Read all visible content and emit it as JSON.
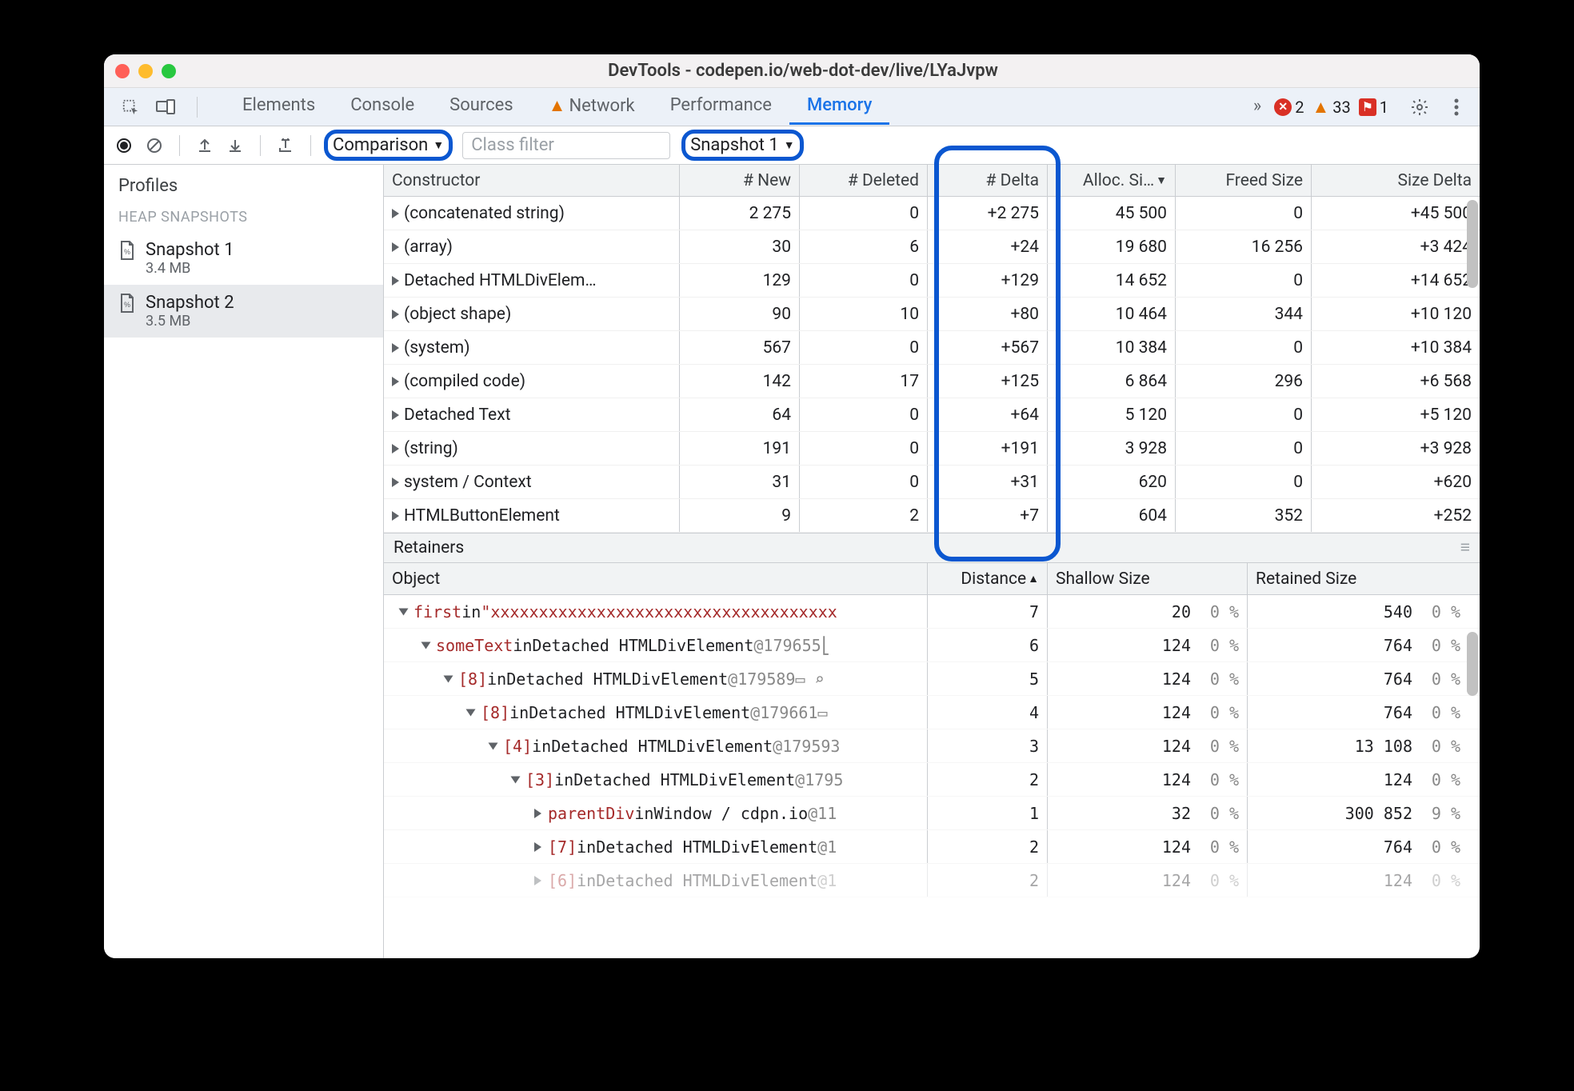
{
  "window": {
    "title": "DevTools - codepen.io/web-dot-dev/live/LYaJvpw"
  },
  "tabs": {
    "items": [
      "Elements",
      "Console",
      "Sources",
      "Network",
      "Performance",
      "Memory"
    ],
    "network_has_warning": true,
    "overflow": "»",
    "active": "Memory"
  },
  "status": {
    "errors": 2,
    "warnings": 33,
    "issues": 1
  },
  "toolbar": {
    "view_mode": "Comparison",
    "filter_placeholder": "Class filter",
    "baseline": "Snapshot 1"
  },
  "sidebar": {
    "title": "Profiles",
    "section": "HEAP SNAPSHOTS",
    "snapshots": [
      {
        "name": "Snapshot 1",
        "size": "3.4 MB",
        "active": false
      },
      {
        "name": "Snapshot 2",
        "size": "3.5 MB",
        "active": true
      }
    ]
  },
  "grid": {
    "headers": {
      "constructor": "Constructor",
      "new": "# New",
      "deleted": "# Deleted",
      "delta": "# Delta",
      "alloc": "Alloc. Si…",
      "freed": "Freed Size",
      "size_delta": "Size Delta"
    },
    "rows": [
      {
        "constructor": "(concatenated string)",
        "new": "2 275",
        "deleted": "0",
        "delta": "+2 275",
        "alloc": "45 500",
        "freed": "0",
        "size_delta": "+45 500"
      },
      {
        "constructor": "(array)",
        "new": "30",
        "deleted": "6",
        "delta": "+24",
        "alloc": "19 680",
        "freed": "16 256",
        "size_delta": "+3 424"
      },
      {
        "constructor": "Detached HTMLDivElem…",
        "new": "129",
        "deleted": "0",
        "delta": "+129",
        "alloc": "14 652",
        "freed": "0",
        "size_delta": "+14 652"
      },
      {
        "constructor": "(object shape)",
        "new": "90",
        "deleted": "10",
        "delta": "+80",
        "alloc": "10 464",
        "freed": "344",
        "size_delta": "+10 120"
      },
      {
        "constructor": "(system)",
        "new": "567",
        "deleted": "0",
        "delta": "+567",
        "alloc": "10 384",
        "freed": "0",
        "size_delta": "+10 384"
      },
      {
        "constructor": "(compiled code)",
        "new": "142",
        "deleted": "17",
        "delta": "+125",
        "alloc": "6 864",
        "freed": "296",
        "size_delta": "+6 568"
      },
      {
        "constructor": "Detached Text",
        "new": "64",
        "deleted": "0",
        "delta": "+64",
        "alloc": "5 120",
        "freed": "0",
        "size_delta": "+5 120"
      },
      {
        "constructor": "(string)",
        "new": "191",
        "deleted": "0",
        "delta": "+191",
        "alloc": "3 928",
        "freed": "0",
        "size_delta": "+3 928"
      },
      {
        "constructor": "system / Context",
        "new": "31",
        "deleted": "0",
        "delta": "+31",
        "alloc": "620",
        "freed": "0",
        "size_delta": "+620"
      },
      {
        "constructor": "HTMLButtonElement",
        "new": "9",
        "deleted": "2",
        "delta": "+7",
        "alloc": "604",
        "freed": "352",
        "size_delta": "+252"
      }
    ]
  },
  "retainers": {
    "title": "Retainers",
    "headers": {
      "object": "Object",
      "distance": "Distance",
      "shallow": "Shallow Size",
      "retained": "Retained Size"
    },
    "rows": [
      {
        "indent": 0,
        "open": true,
        "key": "first",
        "pre": "in ",
        "str": "\"xxxxxxxxxxxxxxxxxxxxxxxxxxxxxxxxxxxx",
        "distance": "7",
        "shallow": "20",
        "shp": "0 %",
        "retained": "540",
        "retp": "0 %"
      },
      {
        "indent": 1,
        "open": true,
        "key": "someText",
        "pre": "in ",
        "type": "Detached HTMLDivElement",
        "id": "@179655",
        "trail": " ⎣",
        "distance": "6",
        "shallow": "124",
        "shp": "0 %",
        "retained": "764",
        "retp": "0 %"
      },
      {
        "indent": 2,
        "open": true,
        "key": "[8]",
        "pre": "in ",
        "type": "Detached HTMLDivElement",
        "id": "@179589",
        "trail": " ▭ ⌕",
        "distance": "5",
        "shallow": "124",
        "shp": "0 %",
        "retained": "764",
        "retp": "0 %"
      },
      {
        "indent": 3,
        "open": true,
        "key": "[8]",
        "pre": "in ",
        "type": "Detached HTMLDivElement",
        "id": "@179661",
        "trail": " ▭",
        "distance": "4",
        "shallow": "124",
        "shp": "0 %",
        "retained": "764",
        "retp": "0 %"
      },
      {
        "indent": 4,
        "open": true,
        "key": "[4]",
        "pre": "in ",
        "type": "Detached HTMLDivElement",
        "id": "@17959",
        "trail": "3",
        "distance": "3",
        "shallow": "124",
        "shp": "0 %",
        "retained": "13 108",
        "retp": "0 %"
      },
      {
        "indent": 5,
        "open": true,
        "key": "[3]",
        "pre": "in ",
        "type": "Detached HTMLDivElement",
        "id": "@179",
        "trail": "5",
        "distance": "2",
        "shallow": "124",
        "shp": "0 %",
        "retained": "124",
        "retp": "0 %"
      },
      {
        "indent": 6,
        "open": false,
        "key": "parentDiv",
        "pre": "in ",
        "type": "Window / cdpn.io",
        "id": "@11",
        "trail": "",
        "distance": "1",
        "shallow": "32",
        "shp": "0 %",
        "retained": "300 852",
        "retp": "9 %"
      },
      {
        "indent": 6,
        "open": false,
        "key": "[7]",
        "pre": "in ",
        "type": "Detached HTMLDivElement",
        "id": "@1",
        "trail": "",
        "distance": "2",
        "shallow": "124",
        "shp": "0 %",
        "retained": "764",
        "retp": "0 %"
      },
      {
        "indent": 6,
        "open": false,
        "key": "[6]",
        "pre": "in ",
        "type": "Detached HTMLDivElement",
        "id": "@1",
        "trail": "",
        "distance": "2",
        "shallow": "124",
        "shp": "0 %",
        "retained": "124",
        "retp": "0 %",
        "faded": true
      }
    ]
  }
}
